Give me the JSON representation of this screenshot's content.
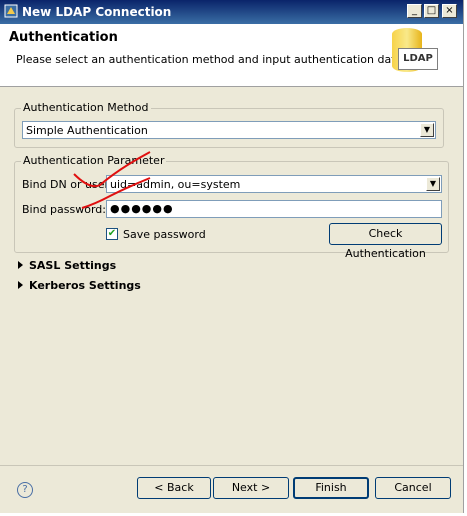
{
  "window": {
    "title": "New LDAP Connection"
  },
  "header": {
    "title": "Authentication",
    "description": "Please select an authentication method and input authentication data.",
    "logo_text": "LDAP"
  },
  "auth_method": {
    "legend": "Authentication Method",
    "selected": "Simple Authentication"
  },
  "auth_param": {
    "legend": "Authentication Parameter",
    "bind_dn_label": "Bind DN or user:",
    "bind_dn_value": "uid=admin, ou=system",
    "bind_password_label": "Bind password:",
    "bind_password_value": "●●●●●●",
    "save_password_label": "Save password",
    "save_password_checked": true,
    "check_auth_label": "Check Authentication"
  },
  "sections": {
    "sasl": "SASL Settings",
    "kerberos": "Kerberos Settings"
  },
  "footer": {
    "back": "< Back",
    "next": "Next >",
    "finish": "Finish",
    "cancel": "Cancel",
    "help": "?"
  }
}
